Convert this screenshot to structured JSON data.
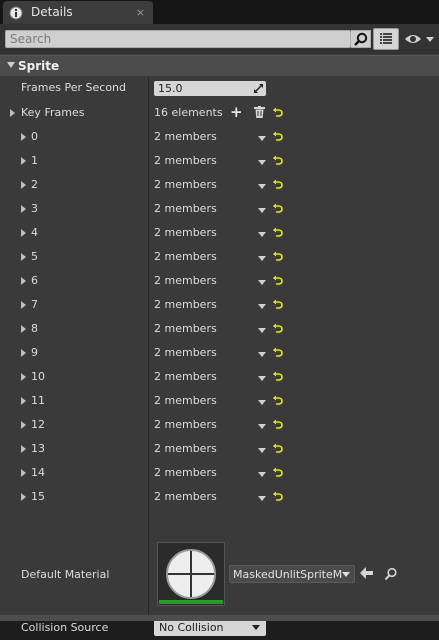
{
  "tab": {
    "title": "Details",
    "icon": "info-icon",
    "close": "×"
  },
  "search": {
    "placeholder": "Search",
    "value": ""
  },
  "category": {
    "label": "Sprite"
  },
  "fps": {
    "label": "Frames Per Second",
    "value": "15.0"
  },
  "key_frames": {
    "label": "Key Frames",
    "count": "16 elements",
    "items": [
      {
        "index": "0",
        "value": "2 members"
      },
      {
        "index": "1",
        "value": "2 members"
      },
      {
        "index": "2",
        "value": "2 members"
      },
      {
        "index": "3",
        "value": "2 members"
      },
      {
        "index": "4",
        "value": "2 members"
      },
      {
        "index": "5",
        "value": "2 members"
      },
      {
        "index": "6",
        "value": "2 members"
      },
      {
        "index": "7",
        "value": "2 members"
      },
      {
        "index": "8",
        "value": "2 members"
      },
      {
        "index": "9",
        "value": "2 members"
      },
      {
        "index": "10",
        "value": "2 members"
      },
      {
        "index": "11",
        "value": "2 members"
      },
      {
        "index": "12",
        "value": "2 members"
      },
      {
        "index": "13",
        "value": "2 members"
      },
      {
        "index": "14",
        "value": "2 members"
      },
      {
        "index": "15",
        "value": "2 members"
      }
    ]
  },
  "material": {
    "label": "Default Material",
    "value": "MaskedUnlitSpriteMa"
  },
  "collision": {
    "label": "Collision Source",
    "value": "No Collision"
  },
  "colors": {
    "reset_arrow": "#e8e81c",
    "thumbnail_bar": "#1da31d"
  }
}
